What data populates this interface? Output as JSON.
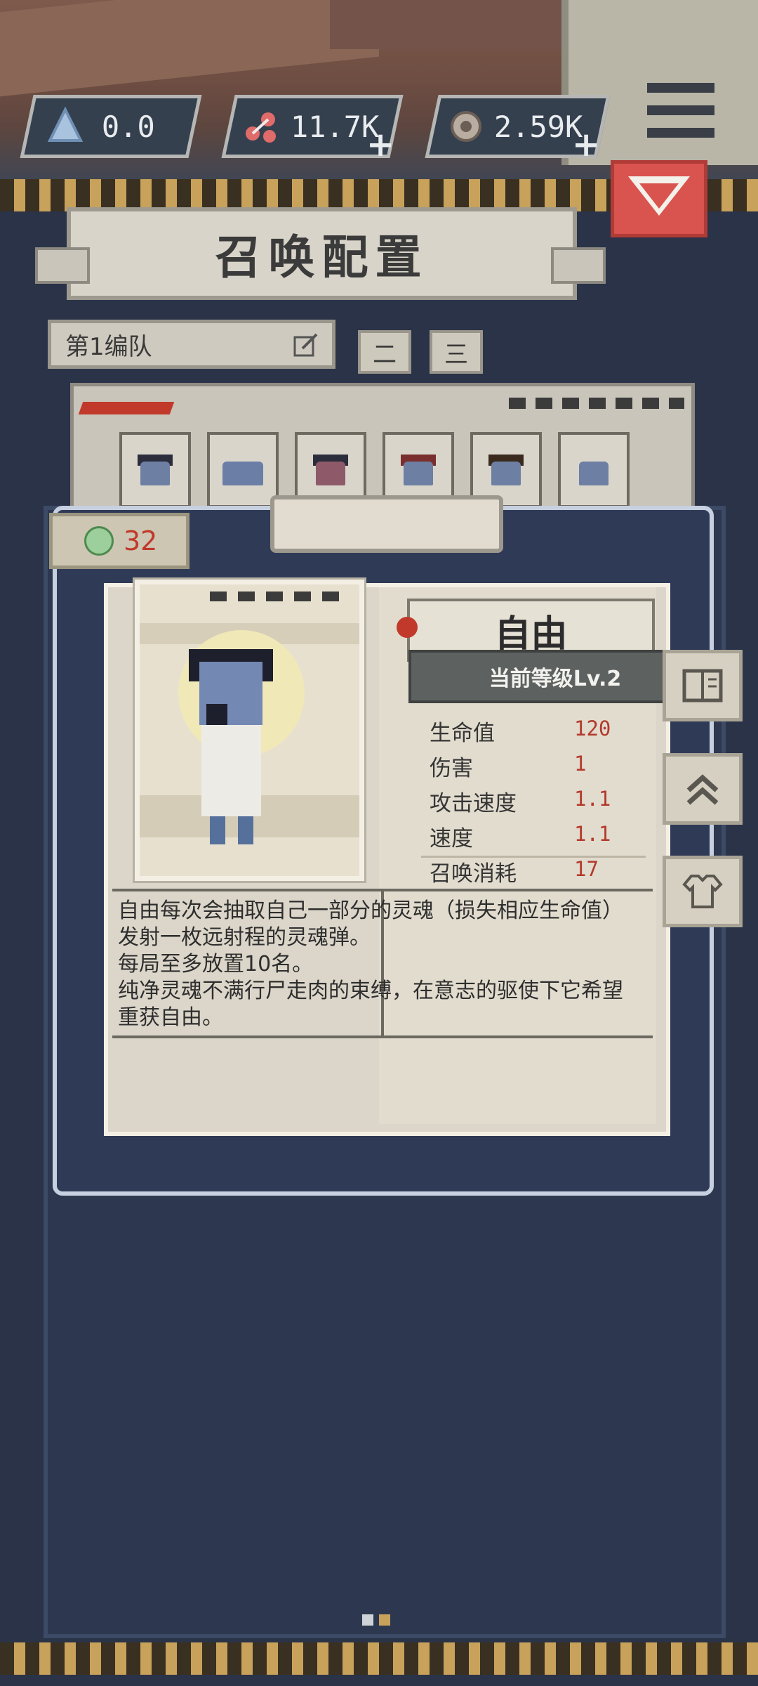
{
  "currencies": [
    {
      "icon": "crystal-icon",
      "value": "0.0",
      "has_plus": false
    },
    {
      "icon": "flesh-icon",
      "value": "11.7K",
      "has_plus": true
    },
    {
      "icon": "soul-icon",
      "value": "2.59K",
      "has_plus": true
    }
  ],
  "title": "召唤配置",
  "team": {
    "label": "第1编队",
    "tab2": "二",
    "tab3": "三"
  },
  "summon_cost": "32",
  "unit": {
    "name": "自由",
    "level": "当前等级Lv.2",
    "stats": [
      {
        "label": "生命值",
        "value": "120"
      },
      {
        "label": "伤害",
        "value": "1"
      },
      {
        "label": "攻击速度",
        "value": "1.1"
      },
      {
        "label": "速度",
        "value": "1.1"
      },
      {
        "label": "召唤消耗",
        "value": "17"
      }
    ],
    "description": "自由每次会抽取自己一部分的灵魂（损失相应生命值）发射一枚远射程的灵魂弹。\n每局至多放置10名。\n纯净灵魂不满行尸走肉的束缚，在意志的驱使下它希望重获自由。"
  },
  "side_buttons": [
    "book-icon",
    "upgrade-icon",
    "outfit-icon"
  ],
  "colors": {
    "accent_red": "#d9534f",
    "stat_value": "#b23a2c",
    "panel_dark": "#2d3850"
  }
}
